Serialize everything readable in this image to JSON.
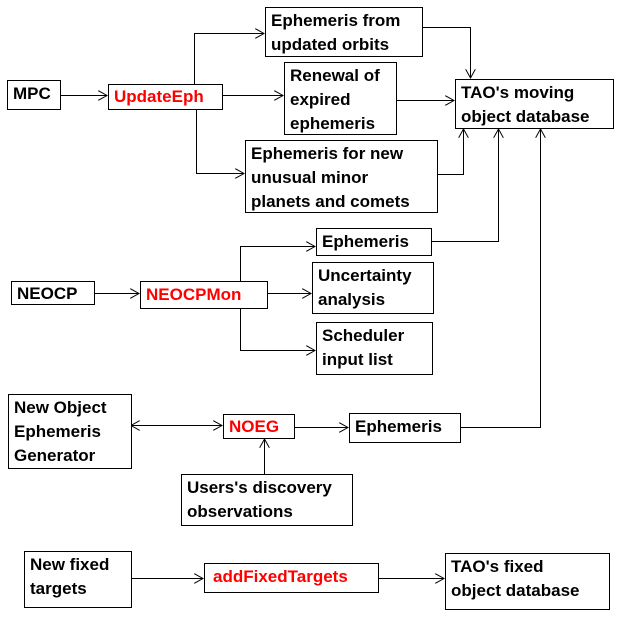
{
  "colors": {
    "process": "#ff0000",
    "line": "#000000"
  },
  "nodes": {
    "mpc": "MPC",
    "update_eph": "UpdateEph",
    "eph_updated_orbits": "Ephemeris from\nupdated orbits",
    "renewal": "Renewal of\nexpired\nephemeris",
    "eph_new_unusual": "Ephemeris for new\nunusual minor\nplanets and comets",
    "tao_moving_db": "TAO's moving\nobject database",
    "neocp": "NEOCP",
    "neocpmon": "NEOCPMon",
    "neocp_ephemeris": "Ephemeris",
    "uncertainty": "Uncertainty\nanalysis",
    "scheduler": "Scheduler\ninput list",
    "noeg_generator": "New Object\nEphemeris\nGenerator",
    "noeg": "NOEG",
    "noeg_ephemeris": "Ephemeris",
    "users_discovery": "Users's discovery\nobservations",
    "new_fixed_targets": "New fixed\ntargets",
    "add_fixed_targets": "addFixedTargets",
    "tao_fixed_db": "TAO's fixed\nobject database"
  }
}
